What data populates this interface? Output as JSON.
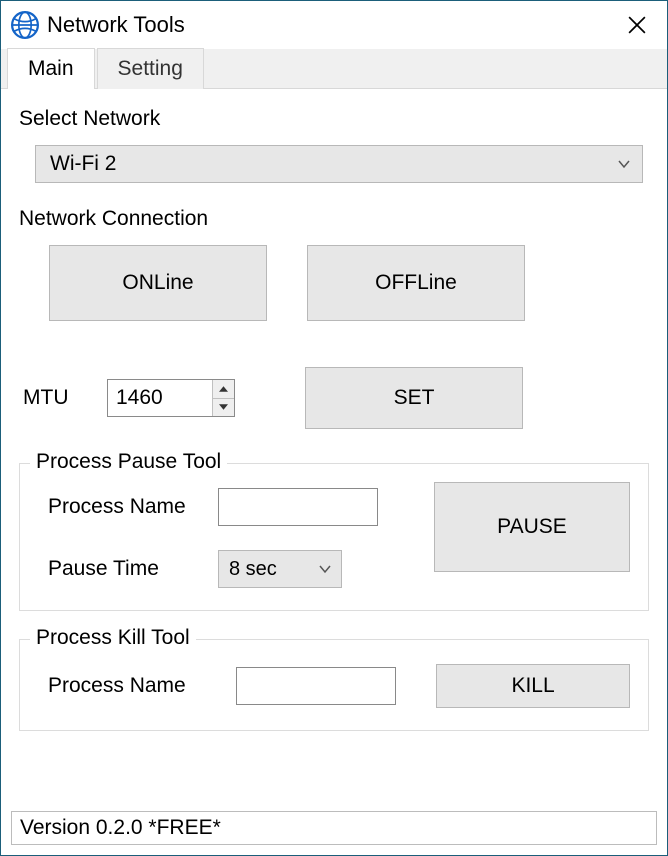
{
  "window": {
    "title": "Network Tools"
  },
  "tabs": {
    "main": "Main",
    "setting": "Setting",
    "active": "main"
  },
  "main": {
    "select_network_label": "Select Network",
    "network_value": "Wi-Fi 2",
    "connection_label": "Network Connection",
    "online_btn": "ONLine",
    "offline_btn": "OFFLine",
    "mtu_label": "MTU",
    "mtu_value": "1460",
    "set_btn": "SET",
    "pause_group": {
      "legend": "Process Pause Tool",
      "name_label": "Process Name",
      "name_value": "",
      "time_label": "Pause Time",
      "time_value": "8 sec",
      "pause_btn": "PAUSE"
    },
    "kill_group": {
      "legend": "Process Kill Tool",
      "name_label": "Process Name",
      "name_value": "",
      "kill_btn": "KILL"
    }
  },
  "status": "Version 0.2.0 *FREE*"
}
